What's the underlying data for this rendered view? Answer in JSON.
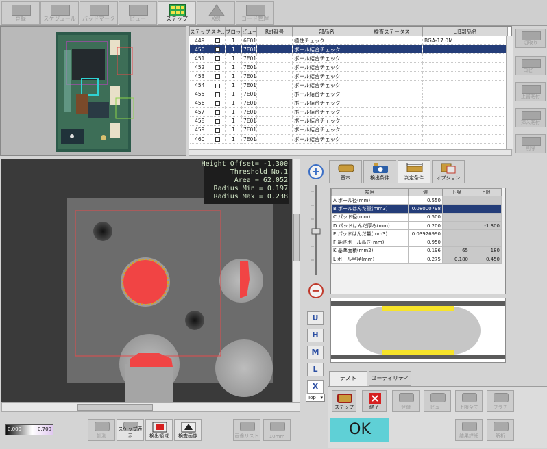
{
  "toolbar": {
    "buttons": [
      {
        "label": "登録"
      },
      {
        "label": "スケジュール"
      },
      {
        "label": "バッドマーク"
      },
      {
        "label": "ビュー"
      },
      {
        "label": "ステップ"
      },
      {
        "label": "X線"
      },
      {
        "label": "コード管理"
      }
    ]
  },
  "step_table": {
    "headers": [
      "ステップ",
      "スキ..",
      "ブロッ..",
      "ビュー",
      "Ref番号",
      "部品名",
      "検査ステータス",
      "LIB部品名"
    ],
    "rows": [
      {
        "step": "449",
        "block": "1",
        "view": "6E01",
        "ref": "",
        "part": "極性チェック",
        "status": "",
        "lib": "BGA-17.0M"
      },
      {
        "step": "450",
        "block": "1",
        "view": "7E01",
        "ref": "",
        "part": "ボール結合チェック",
        "status": "",
        "lib": ""
      },
      {
        "step": "451",
        "block": "1",
        "view": "7E01",
        "ref": "",
        "part": "ボール結合チェック",
        "status": "",
        "lib": ""
      },
      {
        "step": "452",
        "block": "1",
        "view": "7E01",
        "ref": "",
        "part": "ボール結合チェック",
        "status": "",
        "lib": ""
      },
      {
        "step": "453",
        "block": "1",
        "view": "7E01",
        "ref": "",
        "part": "ボール結合チェック",
        "status": "",
        "lib": ""
      },
      {
        "step": "454",
        "block": "1",
        "view": "7E01",
        "ref": "",
        "part": "ボール結合チェック",
        "status": "",
        "lib": ""
      },
      {
        "step": "455",
        "block": "1",
        "view": "7E01",
        "ref": "",
        "part": "ボール結合チェック",
        "status": "",
        "lib": ""
      },
      {
        "step": "456",
        "block": "1",
        "view": "7E01",
        "ref": "",
        "part": "ボール結合チェック",
        "status": "",
        "lib": ""
      },
      {
        "step": "457",
        "block": "1",
        "view": "7E01",
        "ref": "",
        "part": "ボール結合チェック",
        "status": "",
        "lib": ""
      },
      {
        "step": "458",
        "block": "1",
        "view": "7E01",
        "ref": "",
        "part": "ボール結合チェック",
        "status": "",
        "lib": ""
      },
      {
        "step": "459",
        "block": "1",
        "view": "7E01",
        "ref": "",
        "part": "ボール結合チェック",
        "status": "",
        "lib": ""
      },
      {
        "step": "460",
        "block": "1",
        "view": "7E01",
        "ref": "",
        "part": "ボール結合チェック",
        "status": "",
        "lib": ""
      }
    ]
  },
  "side_buttons": [
    "切取り",
    "コピー",
    "上書貼付",
    "挿入貼付",
    "削除"
  ],
  "overlay": {
    "height_offset": "Height Offset= -1.300",
    "threshold": "Threshold No.1",
    "area": "Area = 62.052",
    "radius_min": "Radius Min = 0.197",
    "radius_max": "Radius Max = 0.238"
  },
  "inspect_tabs": [
    "基本",
    "検出条件",
    "判定条件",
    "オプション"
  ],
  "param_table": {
    "headers": [
      "項目",
      "値",
      "下限",
      "上限"
    ],
    "rows": [
      {
        "key": "A",
        "name": "ボール径(mm)",
        "value": "0.550",
        "lower": "",
        "upper": ""
      },
      {
        "key": "B",
        "name": "ボールはんだ量(mm3)",
        "value": "0.08000798",
        "lower": "",
        "upper": ""
      },
      {
        "key": "C",
        "name": "パッド径(mm)",
        "value": "0.500",
        "lower": "",
        "upper": ""
      },
      {
        "key": "D",
        "name": "パッドはんだ厚み(mm)",
        "value": "0.200",
        "lower": "",
        "upper": "-1.300"
      },
      {
        "key": "E",
        "name": "パッドはんだ量(mm3)",
        "value": "0.03926990",
        "lower": "",
        "upper": ""
      },
      {
        "key": "F",
        "name": "最終ボール高さ(mm)",
        "value": "0.950",
        "lower": "",
        "upper": ""
      },
      {
        "key": "K",
        "name": "基準面積(mm2)",
        "value": "0.196",
        "lower": "65",
        "upper": "180"
      },
      {
        "key": "L",
        "name": "ボール半径(mm)",
        "value": "0.275",
        "lower": "0.180",
        "upper": "0.450"
      }
    ]
  },
  "zoom_letters": [
    "U",
    "H",
    "M",
    "L",
    "X"
  ],
  "view_select": "Top",
  "test_tabs": [
    "テスト",
    "ユーティリティ"
  ],
  "test_buttons": [
    {
      "label": "ステップ"
    },
    {
      "label": "終了"
    },
    {
      "label": "登録"
    },
    {
      "label": "ビュー"
    },
    {
      "label": "上限全て"
    },
    {
      "label": "ブラチ"
    }
  ],
  "bottom_buttons": [
    {
      "label": "計測"
    },
    {
      "label": "スケップ表示"
    },
    {
      "label": "検出領域"
    },
    {
      "label": "検査画像"
    },
    {
      "label": "画像リスト"
    },
    {
      "label": "10mm"
    }
  ],
  "result_buttons": [
    "結果詳細",
    "解析"
  ],
  "result": "OK",
  "scale_bar": {
    "min": "0.000",
    "max": "0.700"
  },
  "colors": {
    "selection": "#243d79",
    "ok": "#5fd0d6",
    "detect": "#f03a3a",
    "roi": "#e34b4b",
    "pad_yellow": "#f6e32a"
  }
}
